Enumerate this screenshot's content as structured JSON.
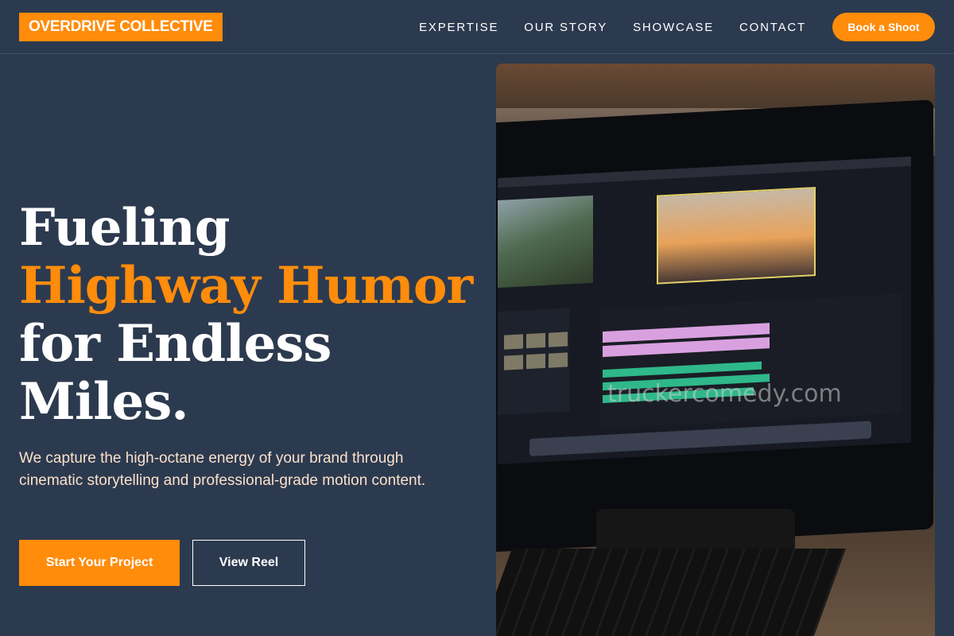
{
  "brand": {
    "name": "OVERDRIVE COLLECTIVE"
  },
  "nav": {
    "items": [
      {
        "label": "EXPERTISE"
      },
      {
        "label": "OUR STORY"
      },
      {
        "label": "SHOWCASE"
      },
      {
        "label": "CONTACT"
      }
    ],
    "cta_label": "Book a Shoot"
  },
  "hero": {
    "headline_lines": [
      {
        "text": "Fueling",
        "accent": false
      },
      {
        "text": "Highway Humor",
        "accent": true
      },
      {
        "text": "for Endless",
        "accent": false
      },
      {
        "text": "Miles.",
        "accent": false
      }
    ],
    "subtext": "We capture the high-octane energy of your brand through cinematic storytelling and professional-grade motion content.",
    "primary_button": "Start Your Project",
    "secondary_button": "View Reel"
  },
  "image": {
    "watermark": "truckercomedy.com"
  },
  "colors": {
    "background": "#2c3a4f",
    "accent": "#ff8c0a",
    "subtext": "#fbe1cc"
  }
}
